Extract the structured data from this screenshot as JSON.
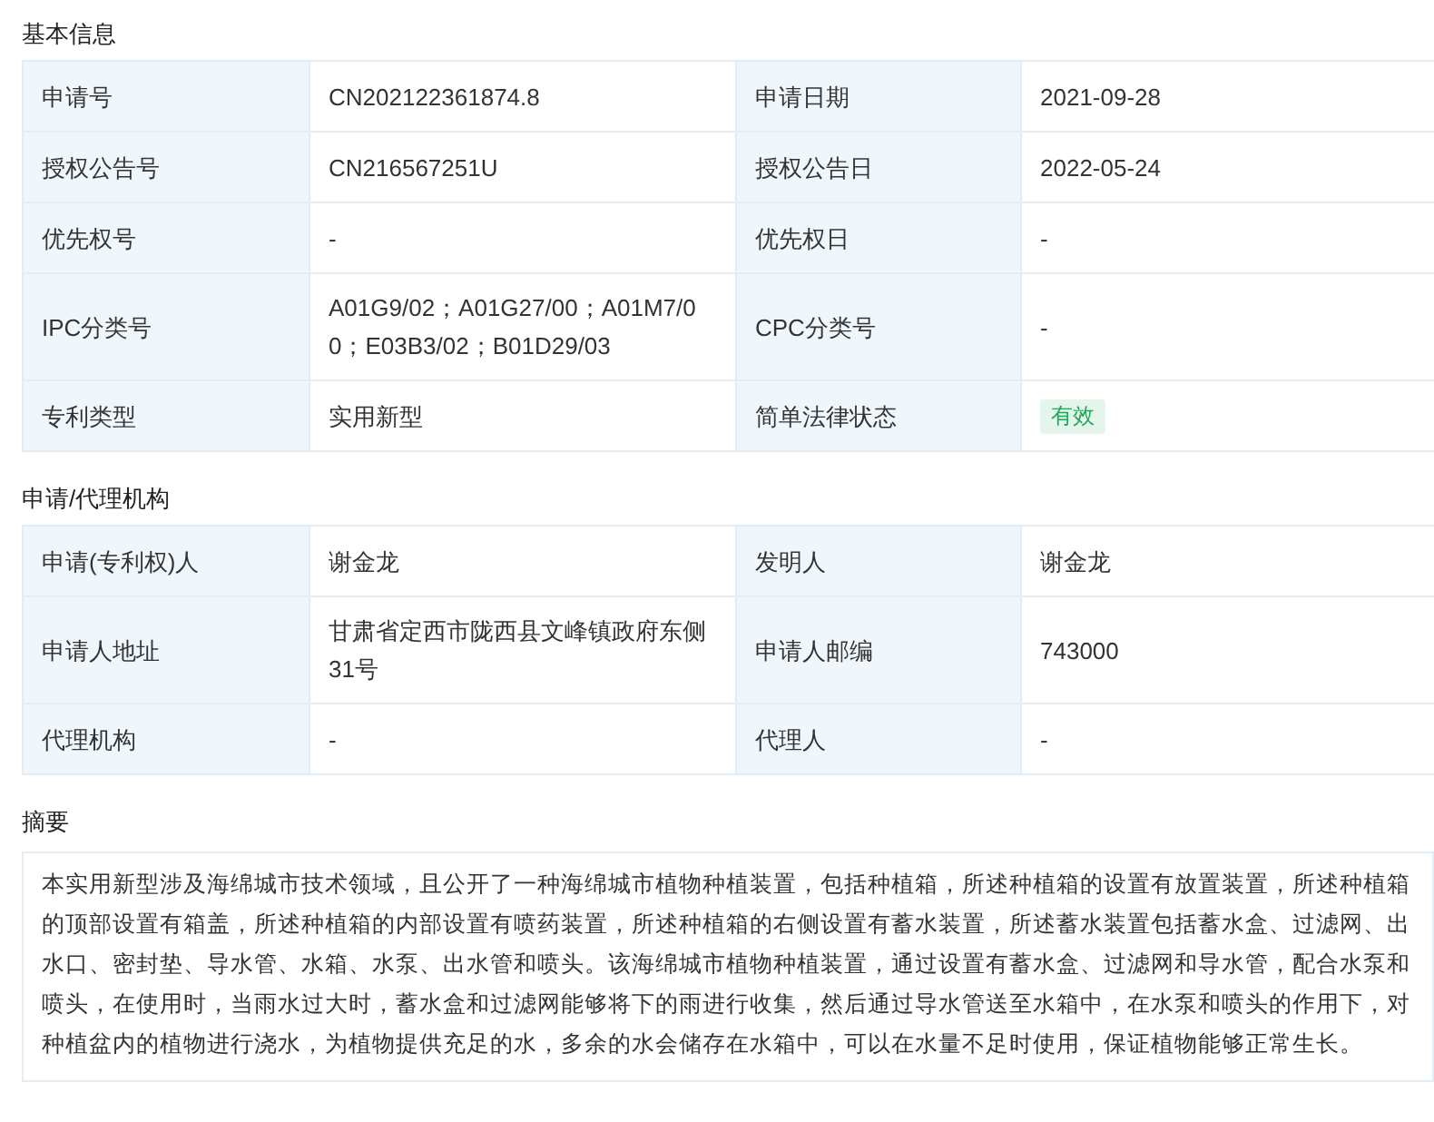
{
  "sections": [
    {
      "title": "基本信息",
      "kind": "table",
      "rows": [
        [
          {
            "label": "申请号",
            "value": "CN202122361874.8",
            "kind": "text"
          },
          {
            "label": "申请日期",
            "value": "2021-09-28",
            "kind": "text"
          }
        ],
        [
          {
            "label": "授权公告号",
            "value": "CN216567251U",
            "kind": "text"
          },
          {
            "label": "授权公告日",
            "value": "2022-05-24",
            "kind": "text"
          }
        ],
        [
          {
            "label": "优先权号",
            "value": "-",
            "kind": "text"
          },
          {
            "label": "优先权日",
            "value": "-",
            "kind": "text"
          }
        ],
        [
          {
            "label": "IPC分类号",
            "value": "A01G9/02；A01G27/00；A01M7/00；E03B3/02；B01D29/03",
            "kind": "text"
          },
          {
            "label": "CPC分类号",
            "value": "-",
            "kind": "text"
          }
        ],
        [
          {
            "label": "专利类型",
            "value": "实用新型",
            "kind": "text"
          },
          {
            "label": "简单法律状态",
            "value": "有效",
            "kind": "tag"
          }
        ]
      ]
    },
    {
      "title": "申请/代理机构",
      "kind": "table",
      "rows": [
        [
          {
            "label": "申请(专利权)人",
            "value": "谢金龙",
            "kind": "text"
          },
          {
            "label": "发明人",
            "value": "谢金龙",
            "kind": "text"
          }
        ],
        [
          {
            "label": "申请人地址",
            "value": "甘肃省定西市陇西县文峰镇政府东侧31号",
            "kind": "text"
          },
          {
            "label": "申请人邮编",
            "value": "743000",
            "kind": "text"
          }
        ],
        [
          {
            "label": "代理机构",
            "value": "-",
            "kind": "text"
          },
          {
            "label": "代理人",
            "value": "-",
            "kind": "text"
          }
        ]
      ]
    },
    {
      "title": "摘要",
      "kind": "text",
      "text": "本实用新型涉及海绵城市技术领域，且公开了一种海绵城市植物种植装置，包括种植箱，所述种植箱的设置有放置装置，所述种植箱的顶部设置有箱盖，所述种植箱的内部设置有喷药装置，所述种植箱的右侧设置有蓄水装置，所述蓄水装置包括蓄水盒、过滤网、出水口、密封垫、导水管、水箱、水泵、出水管和喷头。该海绵城市植物种植装置，通过设置有蓄水盒、过滤网和导水管，配合水泵和喷头，在使用时，当雨水过大时，蓄水盒和过滤网能够将下的雨进行收集，然后通过导水管送至水箱中，在水泵和喷头的作用下，对种植盆内的植物进行浇水，为植物提供充足的水，多余的水会储存在水箱中，可以在水量不足时使用，保证植物能够正常生长。"
    }
  ]
}
